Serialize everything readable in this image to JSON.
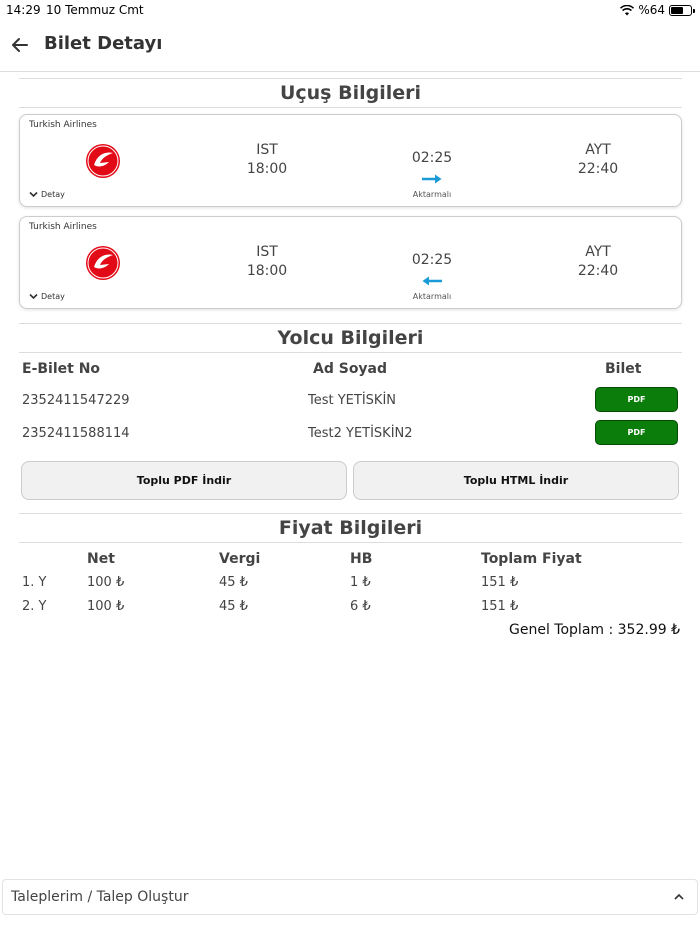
{
  "status": {
    "time": "14:29",
    "date": "10 Temmuz Cmt",
    "battery": "%64",
    "battery_level": 0.64
  },
  "nav": {
    "title": "Bilet Detayı"
  },
  "flight_section": {
    "title": "Uçuş Bilgileri"
  },
  "flights": [
    {
      "airline": "Turkish Airlines",
      "from_code": "IST",
      "dep_time": "18:00",
      "duration": "02:25",
      "transfer": "Aktarmalı",
      "to_code": "AYT",
      "arr_time": "22:40",
      "detail": "Detay",
      "direction": "right-arrow"
    },
    {
      "airline": "Turkish Airlines",
      "from_code": "IST",
      "dep_time": "18:00",
      "duration": "02:25",
      "transfer": "Aktarmalı",
      "to_code": "AYT",
      "arr_time": "22:40",
      "detail": "Detay",
      "direction": "left-arrow"
    }
  ],
  "passenger_section": {
    "title": "Yolcu Bilgileri",
    "headers": {
      "ticket_no": "E-Bilet No",
      "name": "Ad Soyad",
      "ticket": "Bilet"
    },
    "rows": [
      {
        "ticket_no": "2352411547229",
        "name": "Test YETİSKİN",
        "button": "PDF"
      },
      {
        "ticket_no": "2352411588114",
        "name": "Test2 YETİSKİN2",
        "button": "PDF"
      }
    ]
  },
  "bulk": {
    "pdf_label": "Toplu PDF İndir",
    "html_label": "Toplu HTML İndir"
  },
  "price_section": {
    "title": "Fiyat Bilgileri",
    "headers": {
      "net": "Net",
      "tax": "Vergi",
      "hb": "HB",
      "total": "Toplam Fiyat"
    },
    "rows": [
      {
        "label": "1. Y",
        "net": "100 ₺",
        "tax": "45 ₺",
        "hb": "1 ₺",
        "total": "151 ₺"
      },
      {
        "label": "2. Y",
        "net": "100 ₺",
        "tax": "45 ₺",
        "hb": "6 ₺",
        "total": "151 ₺"
      }
    ],
    "grand_total": "Genel Toplam : 352.99 ₺"
  },
  "footer": {
    "requests_label": "Taleplerim / Talep Oluştur"
  },
  "colors": {
    "pdf_green": "#0a7d0a",
    "arrow_blue": "#1a9ad6",
    "thy_red": "#e30a17"
  }
}
